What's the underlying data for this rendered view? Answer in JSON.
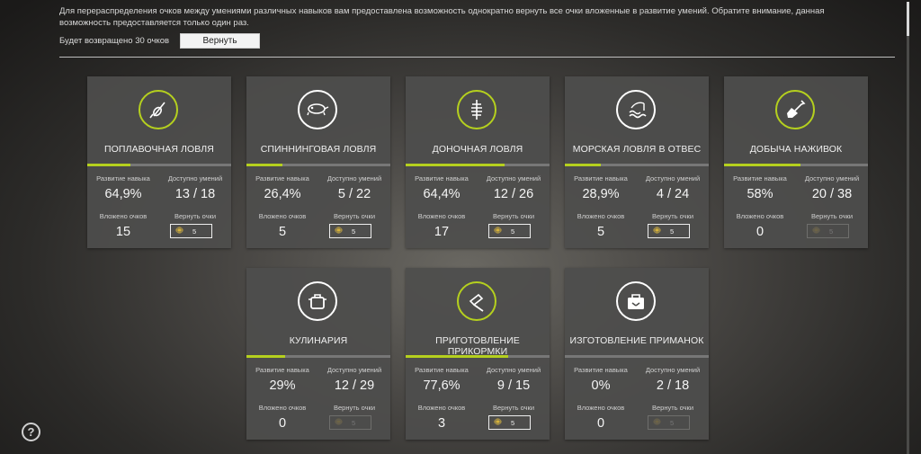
{
  "header": {
    "info_text": "Для перераспределения очков между умениями различных навыков вам предоставлена возможность однократно вернуть все очки вложенные в развитие умений. Обратите внимание, данная возможность предоставляется только один раз.",
    "refund_text": "Будет возвращено 30 очков",
    "refund_button": "Вернуть"
  },
  "labels": {
    "progress": "Развитие навыка",
    "available": "Доступно умений",
    "invested": "Вложено очков",
    "return": "Вернуть очки"
  },
  "help_label": "?",
  "accent_color": "#b5d01e",
  "cards": [
    {
      "title": "ПОПЛАВОЧНАЯ ЛОВЛЯ",
      "icon": "float-icon",
      "progress": "64,9%",
      "available": "13 / 18",
      "invested": "15",
      "return_cost": "5",
      "enabled": true,
      "fill": 0.3,
      "active": true
    },
    {
      "title": "СПИННИНГОВАЯ ЛОВЛЯ",
      "icon": "lure-icon",
      "progress": "26,4%",
      "available": "5 / 22",
      "invested": "5",
      "return_cost": "5",
      "enabled": true,
      "fill": 0.25,
      "active": false
    },
    {
      "title": "ДОНОЧНАЯ ЛОВЛЯ",
      "icon": "feeder-icon",
      "progress": "64,4%",
      "available": "12 / 26",
      "invested": "17",
      "return_cost": "5",
      "enabled": true,
      "fill": 0.69,
      "active": true
    },
    {
      "title": "МОРСКАЯ ЛОВЛЯ В ОТВЕС",
      "icon": "sea-fishing-icon",
      "progress": "28,9%",
      "available": "4 / 24",
      "invested": "5",
      "return_cost": "5",
      "enabled": true,
      "fill": 0.25,
      "active": false
    },
    {
      "title": "ДОБЫЧА НАЖИВОК",
      "icon": "shovel-icon",
      "progress": "58%",
      "available": "20 / 38",
      "invested": "0",
      "return_cost": "5",
      "enabled": false,
      "fill": 0.53,
      "active": true
    },
    {
      "title": "КУЛИНАРИЯ",
      "icon": "pot-icon",
      "progress": "29%",
      "available": "12 / 29",
      "invested": "0",
      "return_cost": "5",
      "enabled": false,
      "fill": 0.27,
      "active": false
    },
    {
      "title": "ПРИГОТОВЛЕНИЕ ПРИКОРМКИ",
      "icon": "mixer-icon",
      "progress": "77,6%",
      "available": "9 / 15",
      "invested": "3",
      "return_cost": "5",
      "enabled": true,
      "fill": 0.71,
      "active": true
    },
    {
      "title": "ИЗГОТОВЛЕНИЕ ПРИМАНОК",
      "icon": "toolbox-icon",
      "progress": "0%",
      "available": "2 / 18",
      "invested": "0",
      "return_cost": "5",
      "enabled": false,
      "fill": 0.0,
      "active": false
    }
  ]
}
